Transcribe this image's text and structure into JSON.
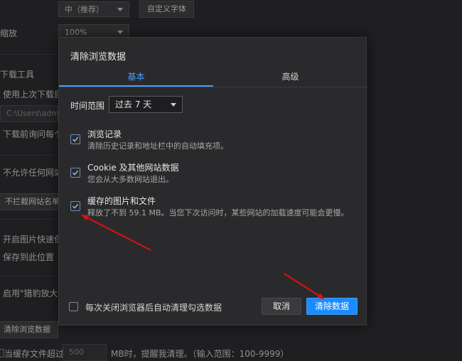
{
  "background_page": {
    "font_size_select": "中（推荐）",
    "custom_font_button": "自定义字体",
    "zoom_label": "缩放",
    "zoom_select": "100%",
    "download_tool_label": "下载工具",
    "use_last_download_dir": "使用上次下载目",
    "download_path_value": "C:\\Users\\adm",
    "ask_before_download": "下载前询问每个",
    "disallow_sites": "不允许任何网站",
    "no_block_list_button": "不拦截网站名单",
    "image_quick_save": "开启图片快速保",
    "save_to_location": "保存到此位置",
    "enable_cheetah_zoom": "启用\"猎豹放大镜",
    "clear_browsing_data_button": "清除浏览数据",
    "cache_exceed_label": "当缓存文件超过",
    "cache_mb_value": "500",
    "cache_suffix": "MB时，提醒我清理。（输入范围：100-9999）"
  },
  "dialog": {
    "title": "清除浏览数据",
    "tabs": [
      {
        "label": "基本",
        "active": true
      },
      {
        "label": "高级",
        "active": false
      }
    ],
    "time_range_label": "时间范围",
    "time_range_value": "过去 7 天",
    "options": [
      {
        "title": "浏览记录",
        "desc": "清除历史记录和地址栏中的自动填充项。",
        "checked": true
      },
      {
        "title": "Cookie 及其他网站数据",
        "desc": "您会从大多数网站退出。",
        "checked": true
      },
      {
        "title": "缓存的图片和文件",
        "desc": "释放了不到 59.1 MB。当您下次访问时，某些网站的加载速度可能会更慢。",
        "checked": true
      }
    ],
    "auto_clear_label": "每次关闭浏览器后自动清理勾选数据",
    "auto_clear_checked": false,
    "cancel_button": "取消",
    "clear_button": "清除数据"
  },
  "colors": {
    "accent": "#1a8cff",
    "tab_active": "#4a9eff",
    "annotation_arrow": "#e01010"
  }
}
